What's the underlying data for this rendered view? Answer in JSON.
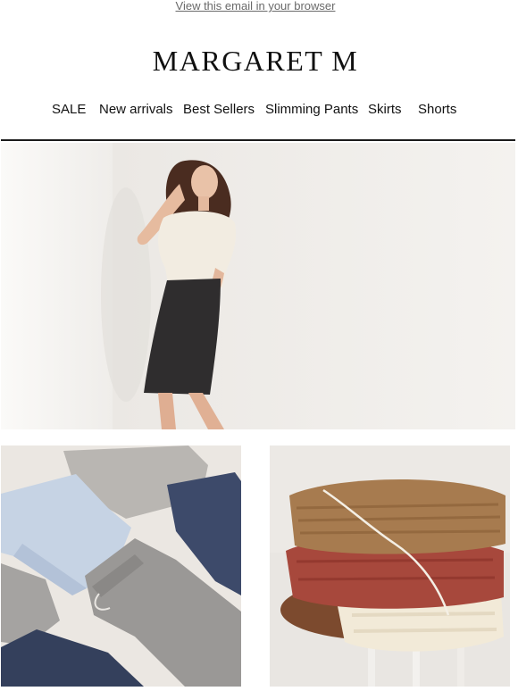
{
  "header": {
    "view_in_browser": "View this email in your browser",
    "brand": "MARGARET M"
  },
  "nav": {
    "items": [
      {
        "label": "SALE"
      },
      {
        "label": "New arrivals"
      },
      {
        "label": "Best Sellers"
      },
      {
        "label": "Slimming Pants"
      },
      {
        "label": "Skirts"
      },
      {
        "label": "Shorts"
      }
    ]
  },
  "colors": {
    "text": "#111111",
    "link": "#6a6a6a",
    "divider": "#1b1b1b",
    "hero_background": "#f1efec"
  }
}
